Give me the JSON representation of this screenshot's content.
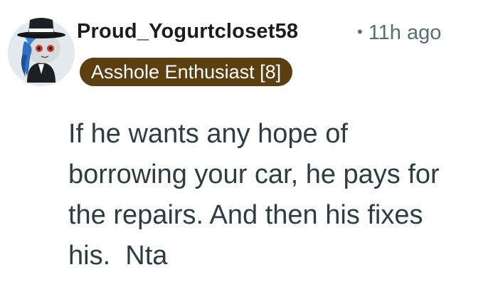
{
  "comment": {
    "author": "Proud_Yogurtcloset58",
    "separator": "•",
    "timestamp": "11h ago",
    "flair": "Asshole Enthusiast [8]",
    "body": "If he wants any hope of\nborrowing your car, he pays for\nthe repairs. And then his fixes\nhis.  Nta",
    "avatar_icon": "snoo-avatar-top-hat-icon"
  },
  "colors": {
    "flair_bg": "#5b3f10",
    "flair_text": "#ffffff",
    "meta_text": "#576f76",
    "body_text": "#303d40",
    "avatar_bg": "#e4e9ee"
  }
}
